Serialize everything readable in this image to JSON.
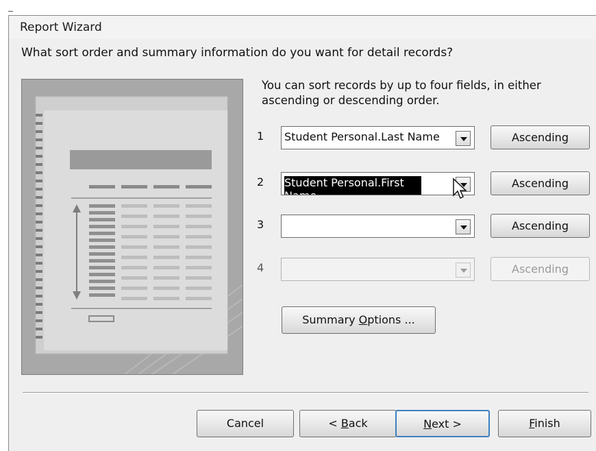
{
  "window": {
    "title": "Report Wizard"
  },
  "question": "What sort order and summary information do you want for detail records?",
  "instructions": "You can sort records by up to four fields, in either ascending or descending order.",
  "sort_rows": [
    {
      "number": "1",
      "value": "Student Personal.Last Name",
      "order_label": "Ascending",
      "enabled": true,
      "selected": false
    },
    {
      "number": "2",
      "value": "Student Personal.First Name",
      "order_label": "Ascending",
      "enabled": true,
      "selected": true
    },
    {
      "number": "3",
      "value": "",
      "order_label": "Ascending",
      "enabled": true,
      "selected": false
    },
    {
      "number": "4",
      "value": "",
      "order_label": "Ascending",
      "enabled": false,
      "selected": false
    }
  ],
  "summary_button": {
    "prefix": "Summary ",
    "accel": "O",
    "suffix": "ptions ..."
  },
  "footer": {
    "cancel": "Cancel",
    "back": {
      "prefix": "< ",
      "accel": "B",
      "suffix": "ack"
    },
    "next": {
      "accel": "N",
      "suffix": "ext >"
    },
    "finish": {
      "accel": "F",
      "suffix": "inish"
    }
  },
  "icons": {
    "dropdown": "chevron-down-icon",
    "cursor": "mouse-pointer-icon",
    "preview": "report-layout-illustration"
  }
}
